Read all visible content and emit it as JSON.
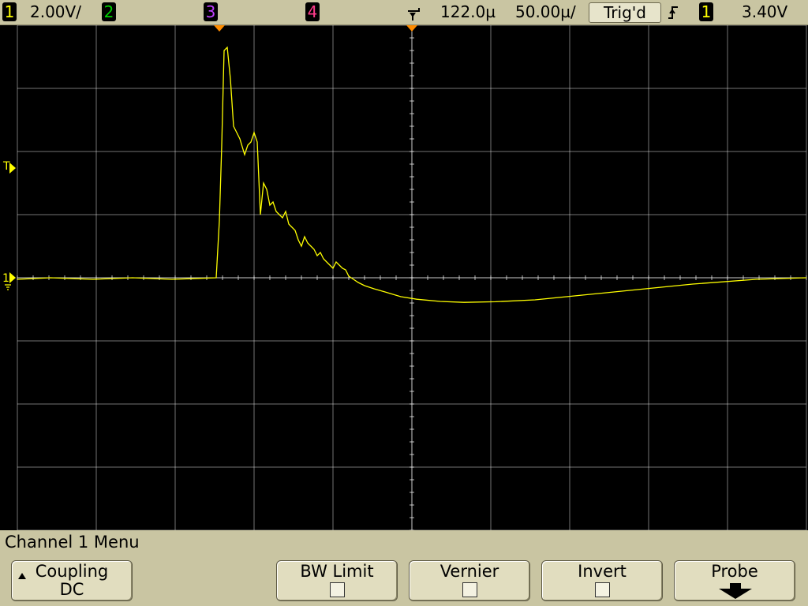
{
  "status_bar": {
    "ch1": {
      "number": "1",
      "scale": "2.00V/",
      "color": "#ffff00"
    },
    "ch2": {
      "number": "2",
      "color": "#00d000"
    },
    "ch3": {
      "number": "3",
      "color": "#c040ff"
    },
    "ch4": {
      "number": "4",
      "color": "#ff3c8c"
    },
    "delay": "122.0µ",
    "timebase": "50.00µ/",
    "trigger_status": "Trig'd",
    "trigger_slope_icon": "rising-edge-icon",
    "trigger_source": "1",
    "trigger_level": "3.40V"
  },
  "screen": {
    "trigger_level_marker": "T",
    "ground_marker": "1",
    "trace_color": "#ffff00",
    "grid_color": "#ffffff"
  },
  "menu": {
    "title": "Channel 1  Menu",
    "softkeys": [
      {
        "label": "Coupling",
        "value": "DC",
        "icon": "up-triangle-icon"
      },
      {
        "label": "BW Limit",
        "checked": false
      },
      {
        "label": "Vernier",
        "checked": false
      },
      {
        "label": "Invert",
        "checked": false
      },
      {
        "label": "Probe",
        "icon": "down-arrow-icon"
      }
    ]
  },
  "chart_data": {
    "type": "line",
    "xlabel": "",
    "ylabel": "",
    "x_unit": "µs",
    "y_unit": "V",
    "xlim": [
      -128,
      372
    ],
    "ylim": [
      -8,
      8
    ],
    "grid": true,
    "series": [
      {
        "x": [
          -128,
          -107,
          -80,
          -55,
          -30,
          -2,
          0,
          1.5,
          3,
          5,
          7,
          9,
          11,
          13,
          16,
          18,
          20,
          22,
          24,
          26,
          28,
          30,
          32,
          34,
          36,
          38,
          40,
          42,
          44,
          46,
          48,
          50,
          52,
          54,
          56,
          58,
          60,
          62,
          64,
          66,
          68,
          70,
          72,
          74,
          76,
          78,
          80,
          82,
          85,
          88,
          92,
          98,
          105,
          115,
          125,
          140,
          155,
          175,
          200,
          230,
          260,
          300,
          340,
          372
        ],
        "y": [
          -0.05,
          0.0,
          -0.05,
          0.0,
          -0.05,
          0.0,
          1.8,
          4.2,
          7.2,
          7.3,
          6.3,
          4.8,
          4.6,
          4.4,
          3.9,
          4.2,
          4.3,
          4.6,
          4.3,
          2.0,
          3.0,
          2.8,
          2.3,
          2.4,
          2.1,
          2.0,
          1.9,
          2.1,
          1.7,
          1.6,
          1.5,
          1.2,
          1.0,
          1.3,
          1.1,
          1.0,
          0.9,
          0.7,
          0.8,
          0.6,
          0.5,
          0.4,
          0.3,
          0.5,
          0.4,
          0.3,
          0.25,
          0.05,
          -0.05,
          -0.15,
          -0.25,
          -0.35,
          -0.45,
          -0.6,
          -0.68,
          -0.75,
          -0.78,
          -0.76,
          -0.7,
          -0.55,
          -0.4,
          -0.2,
          -0.05,
          0.0
        ]
      }
    ]
  }
}
